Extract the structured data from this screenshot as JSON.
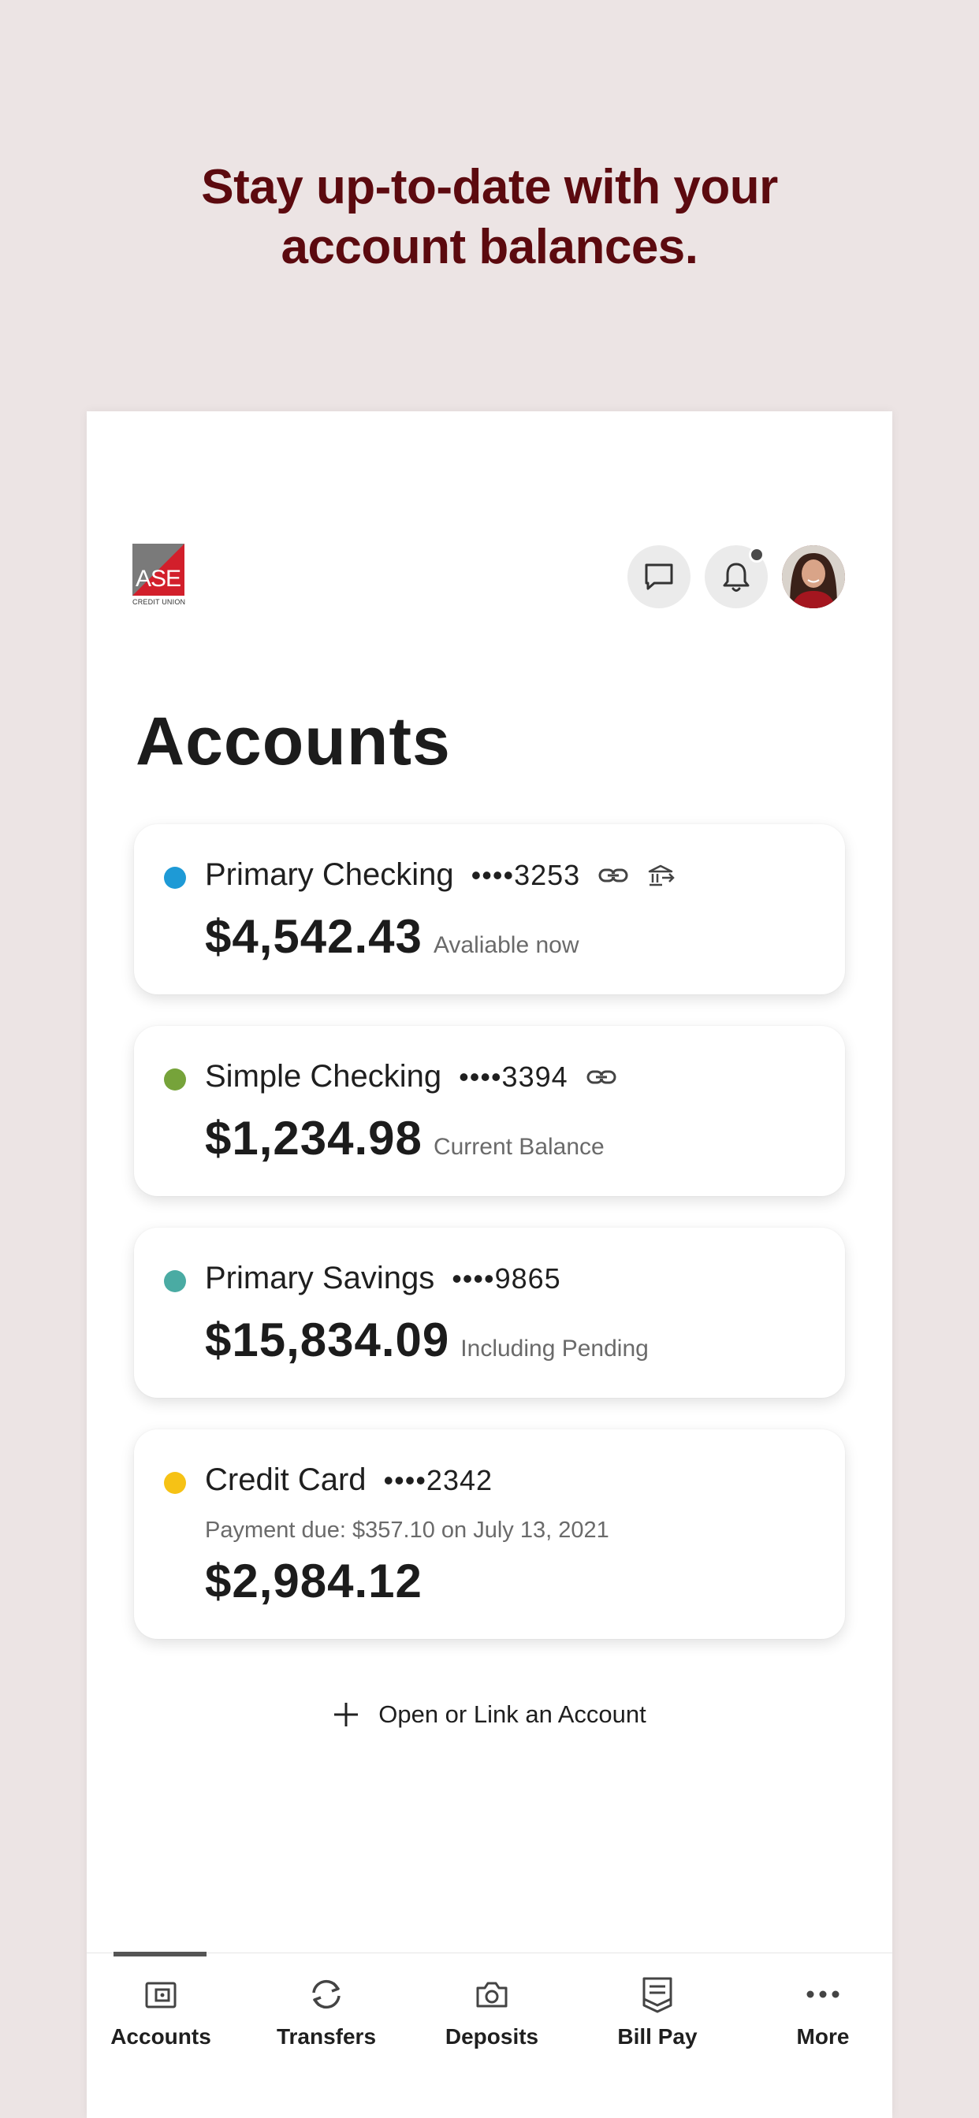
{
  "headline": {
    "line1": "Stay up-to-date with your",
    "line2": "account balances."
  },
  "brand": {
    "logo_text": "ASE",
    "logo_sub": "CREDIT UNION",
    "primary_color": "#d21f2b",
    "headline_color": "#5c0a0f"
  },
  "header": {
    "icons": [
      "chat-icon",
      "bell-icon",
      "avatar"
    ],
    "has_notification": true
  },
  "page": {
    "title": "Accounts"
  },
  "accounts": [
    {
      "name": "Primary Checking",
      "number": "••••3253",
      "amount": "$4,542.43",
      "sub": "Avaliable now",
      "color": "#1e9ad6",
      "icons": [
        "link-icon",
        "bank-transfer-icon"
      ]
    },
    {
      "name": "Simple Checking",
      "number": "••••3394",
      "amount": "$1,234.98",
      "sub": "Current Balance",
      "color": "#76a33a",
      "icons": [
        "link-icon"
      ]
    },
    {
      "name": "Primary Savings",
      "number": "••••9865",
      "amount": "$15,834.09",
      "sub": "Including Pending",
      "color": "#4aaba3",
      "icons": []
    },
    {
      "name": "Credit Card",
      "number": "••••2342",
      "payment_due": "Payment due: $357.10 on July 13, 2021",
      "amount": "$2,984.12",
      "color": "#f6c215",
      "icons": []
    }
  ],
  "open_link": {
    "label": "Open or Link an Account"
  },
  "tabs": [
    {
      "label": "Accounts",
      "icon": "wallet-icon",
      "active": true
    },
    {
      "label": "Transfers",
      "icon": "transfer-icon",
      "active": false
    },
    {
      "label": "Deposits",
      "icon": "camera-icon",
      "active": false
    },
    {
      "label": "Bill Pay",
      "icon": "bill-icon",
      "active": false
    },
    {
      "label": "More",
      "icon": "more-icon",
      "active": false
    }
  ]
}
